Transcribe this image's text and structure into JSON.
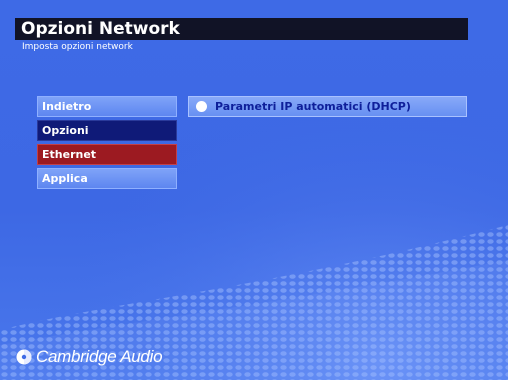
{
  "header": {
    "title": "Opzioni Network",
    "subtitle": "Imposta opzioni network"
  },
  "menu": {
    "items": [
      {
        "label": "Indietro",
        "style": "light"
      },
      {
        "label": "Opzioni",
        "style": "selected-navy"
      },
      {
        "label": "Ethernet",
        "style": "highlight-red"
      },
      {
        "label": "Applica",
        "style": "light"
      }
    ]
  },
  "options": {
    "dhcp_label": "Parametri IP automatici (DHCP)",
    "dhcp_icon": "radio-button-icon"
  },
  "brand": {
    "name": "Cambridge Audio",
    "logo_icon": "cambridge-audio-logo-icon"
  },
  "colors": {
    "background": "#3f6be6",
    "header_bar": "#111326",
    "menu_selected": "#0f1a78",
    "menu_highlight": "#9c1a21",
    "option_text": "#0e1f9a"
  }
}
